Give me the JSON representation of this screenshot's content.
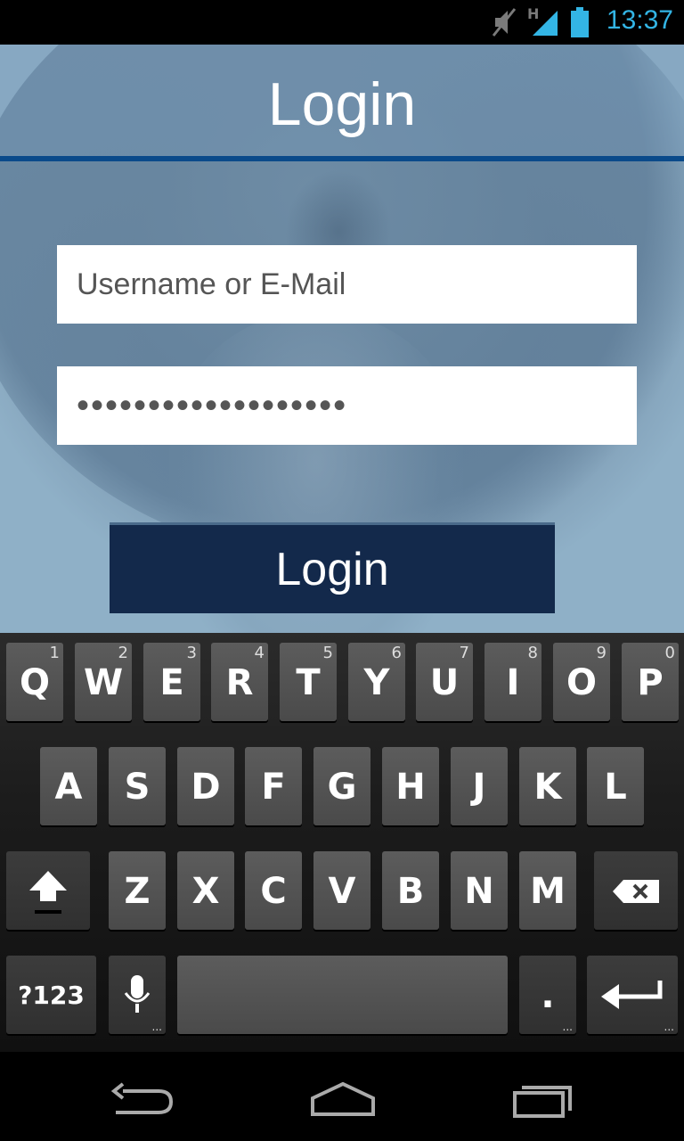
{
  "status_bar": {
    "time": "13:37",
    "network_type": "H",
    "icons": [
      "mute-icon",
      "signal-icon",
      "battery-icon"
    ]
  },
  "app": {
    "title": "Login",
    "username_placeholder": "Username or E-Mail",
    "password_value": "•••••••••••••••••••",
    "login_button_label": "Login"
  },
  "keyboard": {
    "row1": [
      {
        "label": "Q",
        "alt": "1"
      },
      {
        "label": "W",
        "alt": "2"
      },
      {
        "label": "E",
        "alt": "3"
      },
      {
        "label": "R",
        "alt": "4"
      },
      {
        "label": "T",
        "alt": "5"
      },
      {
        "label": "Y",
        "alt": "6"
      },
      {
        "label": "U",
        "alt": "7"
      },
      {
        "label": "I",
        "alt": "8"
      },
      {
        "label": "O",
        "alt": "9"
      },
      {
        "label": "P",
        "alt": "0"
      }
    ],
    "row2": [
      "A",
      "S",
      "D",
      "F",
      "G",
      "H",
      "J",
      "K",
      "L"
    ],
    "row3": [
      "Z",
      "X",
      "C",
      "V",
      "B",
      "N",
      "M"
    ],
    "symbols_label": "?123",
    "period_label": ".",
    "more_dots": "..."
  },
  "colors": {
    "accent": "#33b5e5",
    "title_line": "#0a4a8a",
    "login_button": "#13294b"
  },
  "nav_icons": [
    "back-icon",
    "home-icon",
    "recent-apps-icon"
  ]
}
